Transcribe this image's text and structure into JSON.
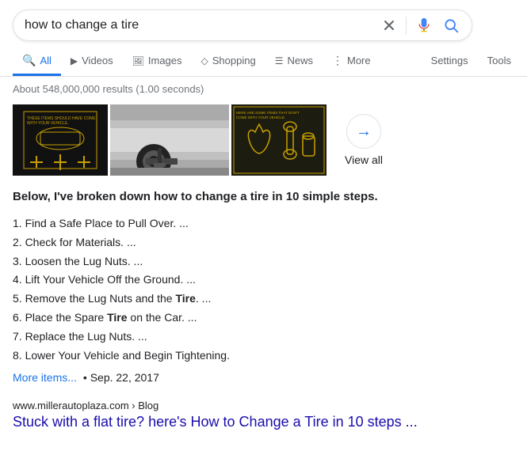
{
  "search": {
    "query": "how to change a tire",
    "placeholder": "Search"
  },
  "nav": {
    "tabs": [
      {
        "id": "all",
        "label": "All",
        "icon": "🔍",
        "active": true
      },
      {
        "id": "videos",
        "label": "Videos",
        "icon": "▶"
      },
      {
        "id": "images",
        "label": "Images",
        "icon": "🖼"
      },
      {
        "id": "shopping",
        "label": "Shopping",
        "icon": "◇"
      },
      {
        "id": "news",
        "label": "News",
        "icon": "☰"
      },
      {
        "id": "more",
        "label": "More",
        "icon": "⋮"
      }
    ],
    "right_tabs": [
      {
        "id": "settings",
        "label": "Settings"
      },
      {
        "id": "tools",
        "label": "Tools"
      }
    ]
  },
  "results": {
    "count_text": "About 548,000,000 results (1.00 seconds)",
    "view_all_label": "View all",
    "view_all_arrow": "→",
    "featured": {
      "intro": "Below, I've broken down how to change a tire in 10 simple steps.",
      "steps": [
        "1. Find a Safe Place to Pull Over. ...",
        "2. Check for Materials. ...",
        "3. Loosen the Lug Nuts. ...",
        "4. Lift Your Vehicle Off the Ground. ...",
        "5. Remove the Lug Nuts and the Tire. ...",
        "6. Place the Spare Tire on the Car. ...",
        "7. Replace the Lug Nuts. ...",
        "8. Lower Your Vehicle and Begin Tightening."
      ],
      "steps_bold": [
        5,
        6
      ],
      "more_items_label": "More items...",
      "date": "• Sep. 22, 2017"
    },
    "organic": [
      {
        "url": "www.millerautoplaza.com › Blog",
        "title": "Stuck with a flat tire? here's How to Change a Tire in 10 steps ..."
      }
    ]
  }
}
